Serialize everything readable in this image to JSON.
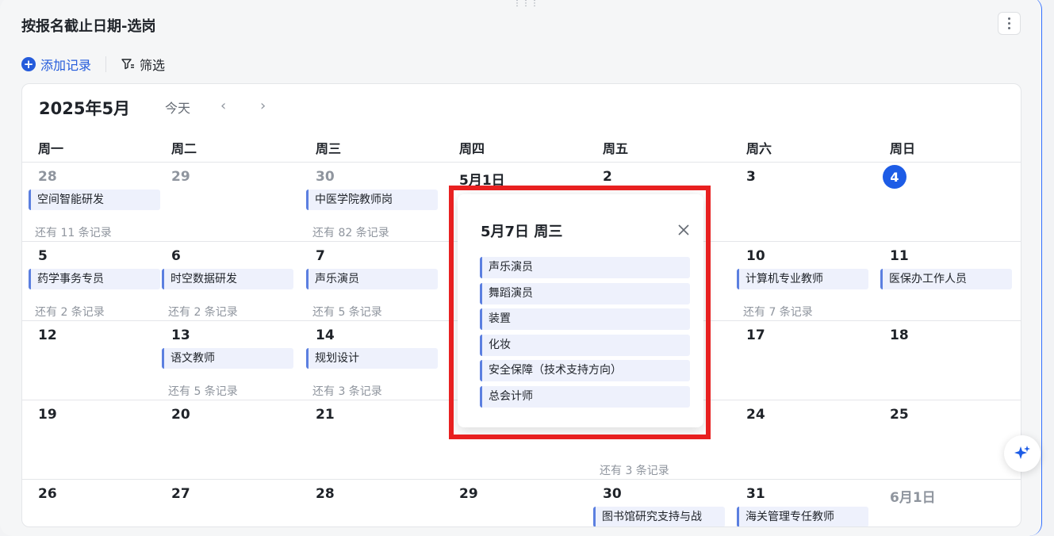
{
  "header": {
    "title": "按报名截止日期-选岗"
  },
  "toolbar": {
    "add_label": "添加记录",
    "filter_label": "筛选"
  },
  "calendar": {
    "month_title": "2025年5月",
    "today_label": "今天",
    "prev_label": "‹",
    "next_label": "›",
    "weekdays": [
      "周一",
      "周二",
      "周三",
      "周四",
      "周五",
      "周六",
      "周日"
    ],
    "rows": [
      {
        "cells": [
          {
            "day": "28",
            "event": "空间智能研发",
            "more": "还有 11 条记录"
          },
          {
            "day": "29"
          },
          {
            "day": "30",
            "event": "中医学院教师岗",
            "more": "还有 82 条记录"
          },
          {
            "day": "5月1日"
          },
          {
            "day": "2"
          },
          {
            "day": "3"
          },
          {
            "day": "4"
          }
        ]
      },
      {
        "cells": [
          {
            "day": "5",
            "event": "药学事务专员",
            "more": "还有 2 条记录"
          },
          {
            "day": "6",
            "event": "时空数据研发",
            "more": "还有 2 条记录"
          },
          {
            "day": "7",
            "event": "声乐演员",
            "more": "还有 5 条记录"
          },
          {
            "day": ""
          },
          {
            "day": ""
          },
          {
            "day": "10",
            "event": "计算机专业教师",
            "more": "还有 7 条记录"
          },
          {
            "day": "11",
            "event": "医保办工作人员"
          }
        ]
      },
      {
        "cells": [
          {
            "day": "12"
          },
          {
            "day": "13",
            "event": "语文教师",
            "more": "还有 5 条记录"
          },
          {
            "day": "14",
            "event": "规划设计",
            "more": "还有 3 条记录"
          },
          {
            "day": ""
          },
          {
            "day": ""
          },
          {
            "day": "17"
          },
          {
            "day": "18"
          }
        ]
      },
      {
        "cells": [
          {
            "day": "19"
          },
          {
            "day": "20"
          },
          {
            "day": "21"
          },
          {
            "day": ""
          },
          {
            "day": "",
            "more": "还有 3 条记录"
          },
          {
            "day": "24"
          },
          {
            "day": "25"
          }
        ]
      },
      {
        "cells": [
          {
            "day": "26"
          },
          {
            "day": "27"
          },
          {
            "day": "28"
          },
          {
            "day": "29"
          },
          {
            "day": "30",
            "event": "图书馆研究支持与战"
          },
          {
            "day": "31",
            "event": "海关管理专任教师"
          },
          {
            "day": "6月1日"
          }
        ]
      }
    ]
  },
  "popup": {
    "title": "5月7日 周三",
    "events": [
      "声乐演员",
      "舞蹈演员",
      "装置",
      "化妆",
      "安全保障（技术支持方向）",
      "总会计师"
    ]
  },
  "colors": {
    "accent": "#245bdb",
    "today": "#1d5ce6",
    "highlight": "#e82020",
    "event_bar": "#5b7fe0"
  },
  "icons": {
    "add": "plus-circle-icon",
    "filter": "filter-icon",
    "close": "close-icon",
    "more": "more-vertical-icon",
    "ai": "sparkle-icon"
  }
}
